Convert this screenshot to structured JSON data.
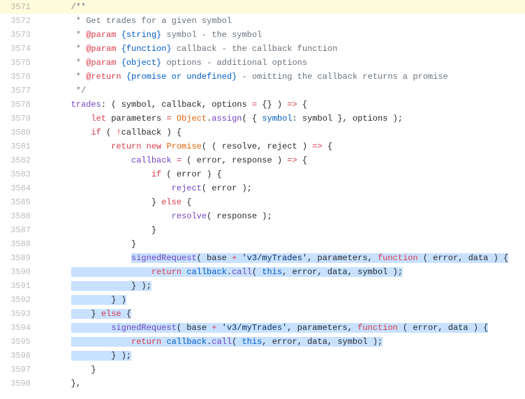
{
  "lines": [
    {
      "num": "3571",
      "hl": true,
      "tokens": [
        {
          "cls": "c-comment",
          "txt": "/**"
        }
      ]
    },
    {
      "num": "3572",
      "tokens": [
        {
          "cls": "c-comment",
          "txt": " * Get trades for a given symbol"
        }
      ]
    },
    {
      "num": "3573",
      "tokens": [
        {
          "cls": "c-comment",
          "txt": " * "
        },
        {
          "cls": "c-jsdoc",
          "txt": "@param"
        },
        {
          "cls": "c-comment",
          "txt": " "
        },
        {
          "cls": "c-prop",
          "txt": "{string}"
        },
        {
          "cls": "c-comment",
          "txt": " symbol - the symbol"
        }
      ]
    },
    {
      "num": "3574",
      "tokens": [
        {
          "cls": "c-comment",
          "txt": " * "
        },
        {
          "cls": "c-jsdoc",
          "txt": "@param"
        },
        {
          "cls": "c-comment",
          "txt": " "
        },
        {
          "cls": "c-prop",
          "txt": "{function}"
        },
        {
          "cls": "c-comment",
          "txt": " callback - the callback function"
        }
      ]
    },
    {
      "num": "3575",
      "tokens": [
        {
          "cls": "c-comment",
          "txt": " * "
        },
        {
          "cls": "c-jsdoc",
          "txt": "@param"
        },
        {
          "cls": "c-comment",
          "txt": " "
        },
        {
          "cls": "c-prop",
          "txt": "{object}"
        },
        {
          "cls": "c-comment",
          "txt": " options - additional options"
        }
      ]
    },
    {
      "num": "3576",
      "tokens": [
        {
          "cls": "c-comment",
          "txt": " * "
        },
        {
          "cls": "c-jsdoc",
          "txt": "@return"
        },
        {
          "cls": "c-comment",
          "txt": " "
        },
        {
          "cls": "c-prop",
          "txt": "{promise or undefined}"
        },
        {
          "cls": "c-comment",
          "txt": " - omitting the callback returns a promise"
        }
      ]
    },
    {
      "num": "3577",
      "tokens": [
        {
          "cls": "c-comment",
          "txt": " */"
        }
      ]
    },
    {
      "num": "3578",
      "tokens": [
        {
          "cls": "c-func",
          "txt": "trades"
        },
        {
          "cls": "c-plain",
          "txt": ": ( "
        },
        {
          "cls": "c-plain",
          "txt": "symbol"
        },
        {
          "cls": "c-plain",
          "txt": ", "
        },
        {
          "cls": "c-plain",
          "txt": "callback"
        },
        {
          "cls": "c-plain",
          "txt": ", "
        },
        {
          "cls": "c-plain",
          "txt": "options"
        },
        {
          "cls": "c-plain",
          "txt": " "
        },
        {
          "cls": "c-keyword",
          "txt": "="
        },
        {
          "cls": "c-plain",
          "txt": " {} ) "
        },
        {
          "cls": "c-keyword",
          "txt": "=>"
        },
        {
          "cls": "c-plain",
          "txt": " {"
        }
      ]
    },
    {
      "num": "3579",
      "tokens": [
        {
          "cls": "c-plain",
          "txt": "    "
        },
        {
          "cls": "c-keyword",
          "txt": "let"
        },
        {
          "cls": "c-plain",
          "txt": " parameters "
        },
        {
          "cls": "c-keyword",
          "txt": "="
        },
        {
          "cls": "c-plain",
          "txt": " "
        },
        {
          "cls": "c-constant",
          "txt": "Object"
        },
        {
          "cls": "c-plain",
          "txt": "."
        },
        {
          "cls": "c-func",
          "txt": "assign"
        },
        {
          "cls": "c-plain",
          "txt": "( { "
        },
        {
          "cls": "c-prop",
          "txt": "symbol"
        },
        {
          "cls": "c-plain",
          "txt": ": symbol }, options );"
        }
      ]
    },
    {
      "num": "3580",
      "tokens": [
        {
          "cls": "c-plain",
          "txt": "    "
        },
        {
          "cls": "c-keyword",
          "txt": "if"
        },
        {
          "cls": "c-plain",
          "txt": " ( "
        },
        {
          "cls": "c-keyword",
          "txt": "!"
        },
        {
          "cls": "c-plain",
          "txt": "callback ) {"
        }
      ]
    },
    {
      "num": "3581",
      "tokens": [
        {
          "cls": "c-plain",
          "txt": "        "
        },
        {
          "cls": "c-keyword",
          "txt": "return"
        },
        {
          "cls": "c-plain",
          "txt": " "
        },
        {
          "cls": "c-keyword",
          "txt": "new"
        },
        {
          "cls": "c-plain",
          "txt": " "
        },
        {
          "cls": "c-constant",
          "txt": "Promise"
        },
        {
          "cls": "c-plain",
          "txt": "( ( "
        },
        {
          "cls": "c-plain",
          "txt": "resolve"
        },
        {
          "cls": "c-plain",
          "txt": ", "
        },
        {
          "cls": "c-plain",
          "txt": "reject"
        },
        {
          "cls": "c-plain",
          "txt": " ) "
        },
        {
          "cls": "c-keyword",
          "txt": "=>"
        },
        {
          "cls": "c-plain",
          "txt": " {"
        }
      ]
    },
    {
      "num": "3582",
      "tokens": [
        {
          "cls": "c-plain",
          "txt": "            "
        },
        {
          "cls": "c-func",
          "txt": "callback"
        },
        {
          "cls": "c-plain",
          "txt": " "
        },
        {
          "cls": "c-keyword",
          "txt": "="
        },
        {
          "cls": "c-plain",
          "txt": " ( "
        },
        {
          "cls": "c-plain",
          "txt": "error"
        },
        {
          "cls": "c-plain",
          "txt": ", "
        },
        {
          "cls": "c-plain",
          "txt": "response"
        },
        {
          "cls": "c-plain",
          "txt": " ) "
        },
        {
          "cls": "c-keyword",
          "txt": "=>"
        },
        {
          "cls": "c-plain",
          "txt": " {"
        }
      ]
    },
    {
      "num": "3583",
      "tokens": [
        {
          "cls": "c-plain",
          "txt": "                "
        },
        {
          "cls": "c-keyword",
          "txt": "if"
        },
        {
          "cls": "c-plain",
          "txt": " ( error ) {"
        }
      ]
    },
    {
      "num": "3584",
      "tokens": [
        {
          "cls": "c-plain",
          "txt": "                    "
        },
        {
          "cls": "c-func",
          "txt": "reject"
        },
        {
          "cls": "c-plain",
          "txt": "( error );"
        }
      ]
    },
    {
      "num": "3585",
      "tokens": [
        {
          "cls": "c-plain",
          "txt": "                } "
        },
        {
          "cls": "c-keyword",
          "txt": "else"
        },
        {
          "cls": "c-plain",
          "txt": " {"
        }
      ]
    },
    {
      "num": "3586",
      "tokens": [
        {
          "cls": "c-plain",
          "txt": "                    "
        },
        {
          "cls": "c-func",
          "txt": "resolve"
        },
        {
          "cls": "c-plain",
          "txt": "( response );"
        }
      ]
    },
    {
      "num": "3587",
      "tokens": [
        {
          "cls": "c-plain",
          "txt": "                }"
        }
      ]
    },
    {
      "num": "3588",
      "tokens": [
        {
          "cls": "c-plain",
          "txt": "            }"
        }
      ]
    },
    {
      "num": "3589",
      "sel": "start",
      "tokens": [
        {
          "cls": "c-plain",
          "txt": "            "
        },
        {
          "cls": "c-func sel",
          "txt": "signedRequest"
        },
        {
          "cls": "c-plain sel",
          "txt": "( base "
        },
        {
          "cls": "c-keyword sel",
          "txt": "+"
        },
        {
          "cls": "c-plain sel",
          "txt": " "
        },
        {
          "cls": "c-str sel",
          "txt": "'v3/myTrades'"
        },
        {
          "cls": "c-plain sel",
          "txt": ", parameters, "
        },
        {
          "cls": "c-keyword sel",
          "txt": "function"
        },
        {
          "cls": "c-plain sel",
          "txt": " ( "
        },
        {
          "cls": "c-plain sel",
          "txt": "error"
        },
        {
          "cls": "c-plain sel",
          "txt": ", "
        },
        {
          "cls": "c-plain sel",
          "txt": "data"
        },
        {
          "cls": "c-plain sel",
          "txt": " ) {"
        }
      ]
    },
    {
      "num": "3590",
      "sel": "full",
      "tokens": [
        {
          "cls": "c-plain sel",
          "txt": "                "
        },
        {
          "cls": "c-keyword sel",
          "txt": "return"
        },
        {
          "cls": "c-plain sel",
          "txt": " "
        },
        {
          "cls": "c-prop sel",
          "txt": "callback"
        },
        {
          "cls": "c-plain sel",
          "txt": "."
        },
        {
          "cls": "c-func sel",
          "txt": "call"
        },
        {
          "cls": "c-plain sel",
          "txt": "( "
        },
        {
          "cls": "c-def sel",
          "txt": "this"
        },
        {
          "cls": "c-plain sel",
          "txt": ", error, data, symbol );"
        }
      ]
    },
    {
      "num": "3591",
      "sel": "full",
      "tokens": [
        {
          "cls": "c-plain sel",
          "txt": "            } );"
        }
      ]
    },
    {
      "num": "3592",
      "sel": "full",
      "tokens": [
        {
          "cls": "c-plain sel",
          "txt": "        } )"
        }
      ]
    },
    {
      "num": "3593",
      "sel": "full",
      "tokens": [
        {
          "cls": "c-plain sel",
          "txt": "    } "
        },
        {
          "cls": "c-keyword sel",
          "txt": "else"
        },
        {
          "cls": "c-plain sel",
          "txt": " {"
        }
      ]
    },
    {
      "num": "3594",
      "sel": "full",
      "tokens": [
        {
          "cls": "c-plain sel",
          "txt": "        "
        },
        {
          "cls": "c-func sel",
          "txt": "signedRequest"
        },
        {
          "cls": "c-plain sel",
          "txt": "( base "
        },
        {
          "cls": "c-keyword sel",
          "txt": "+"
        },
        {
          "cls": "c-plain sel",
          "txt": " "
        },
        {
          "cls": "c-str sel",
          "txt": "'v3/myTrades'"
        },
        {
          "cls": "c-plain sel",
          "txt": ", parameters, "
        },
        {
          "cls": "c-keyword sel",
          "txt": "function"
        },
        {
          "cls": "c-plain sel",
          "txt": " ( "
        },
        {
          "cls": "c-plain sel",
          "txt": "error"
        },
        {
          "cls": "c-plain sel",
          "txt": ", "
        },
        {
          "cls": "c-plain sel",
          "txt": "data"
        },
        {
          "cls": "c-plain sel",
          "txt": " ) {"
        }
      ]
    },
    {
      "num": "3595",
      "sel": "full",
      "tokens": [
        {
          "cls": "c-plain sel",
          "txt": "            "
        },
        {
          "cls": "c-keyword sel",
          "txt": "return"
        },
        {
          "cls": "c-plain sel",
          "txt": " "
        },
        {
          "cls": "c-prop sel",
          "txt": "callback"
        },
        {
          "cls": "c-plain sel",
          "txt": "."
        },
        {
          "cls": "c-func sel",
          "txt": "call"
        },
        {
          "cls": "c-plain sel",
          "txt": "( "
        },
        {
          "cls": "c-def sel",
          "txt": "this"
        },
        {
          "cls": "c-plain sel",
          "txt": ", error, data, symbol );"
        }
      ]
    },
    {
      "num": "3596",
      "sel": "end",
      "tokens": [
        {
          "cls": "c-plain sel",
          "txt": "        } );"
        }
      ]
    },
    {
      "num": "3597",
      "tokens": [
        {
          "cls": "c-plain",
          "txt": "    }"
        }
      ]
    },
    {
      "num": "3598",
      "tokens": [
        {
          "cls": "c-plain",
          "txt": "},"
        }
      ]
    }
  ],
  "indent": "        "
}
